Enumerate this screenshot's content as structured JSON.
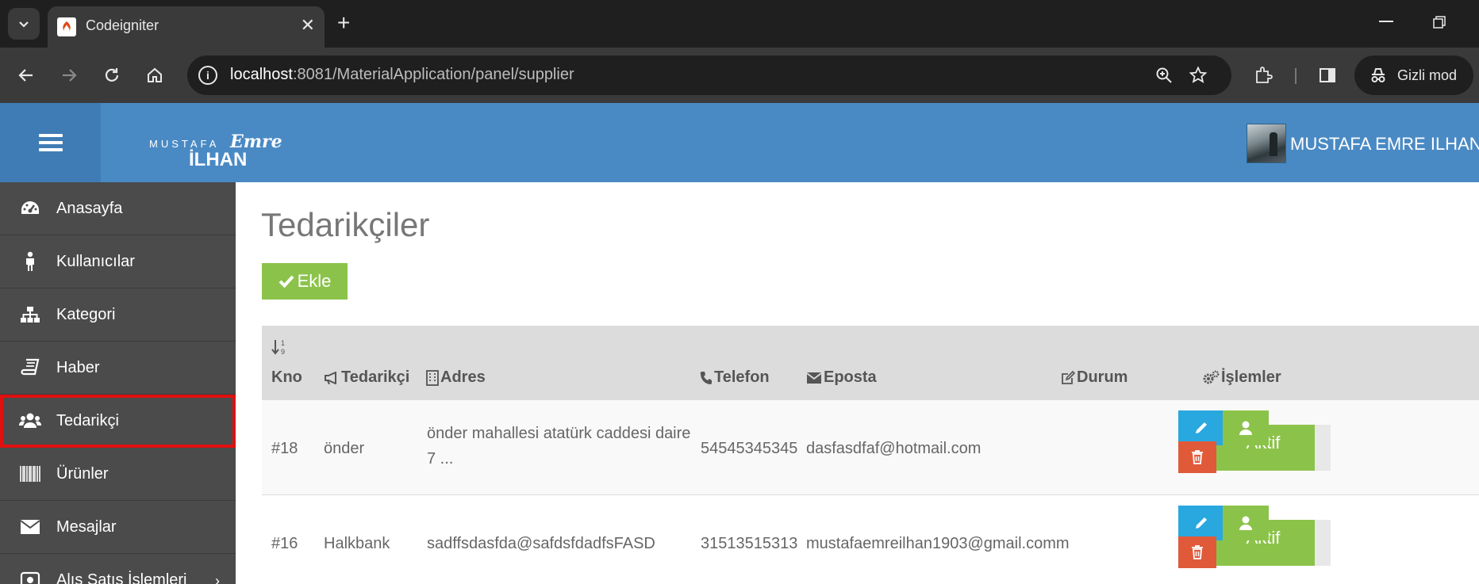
{
  "browser": {
    "tab_title": "Codeigniter",
    "url_host": "localhost",
    "url_rest": ":8081/MaterialApplication/panel/supplier",
    "incognito_label": "Gizli mod"
  },
  "header": {
    "logo_first": "MUSTAFA",
    "logo_middle": "Emre",
    "logo_last": "İLHAN",
    "user_name": "MUSTAFA EMRE ILHAN",
    "color": "#4a8ac4"
  },
  "sidebar": {
    "items": [
      {
        "label": "Anasayfa",
        "icon": "dashboard-icon"
      },
      {
        "label": "Kullanıcılar",
        "icon": "person-icon"
      },
      {
        "label": "Kategori",
        "icon": "sitemap-icon"
      },
      {
        "label": "Haber",
        "icon": "book-icon"
      },
      {
        "label": "Tedarikçi",
        "icon": "users-icon",
        "active": true
      },
      {
        "label": "Ürünler",
        "icon": "barcode-icon"
      },
      {
        "label": "Mesajlar",
        "icon": "envelope-icon"
      },
      {
        "label": "Alış Satış İşlemleri",
        "icon": "money-icon"
      }
    ]
  },
  "main": {
    "title": "Tedarikçiler",
    "add_label": "Ekle",
    "columns": {
      "no": "Kno",
      "supplier": "Tedarikçi",
      "address": "Adres",
      "phone": "Telefon",
      "email": "Eposta",
      "status": "Durum",
      "actions": "İşlemler"
    },
    "rows": [
      {
        "no": "#18",
        "supplier": "önder",
        "address": "önder mahallesi atatürk caddesi daire 7 ...",
        "phone": "54545345345",
        "email": "dasfasdfaf@hotmail.com",
        "status": "Aktif"
      },
      {
        "no": "#16",
        "supplier": "Halkbank",
        "address": "sadffsdasfda@safdsfdadfsFASD",
        "phone": "31513515313",
        "email": "mustafaemreilhan1903@gmail.comm",
        "status": "Aktif"
      }
    ]
  },
  "colors": {
    "accent_green": "#8bc34a",
    "edit_blue": "#29a8e0",
    "delete_red": "#e05a3a",
    "sidebar_bg": "#4b4b4b"
  }
}
